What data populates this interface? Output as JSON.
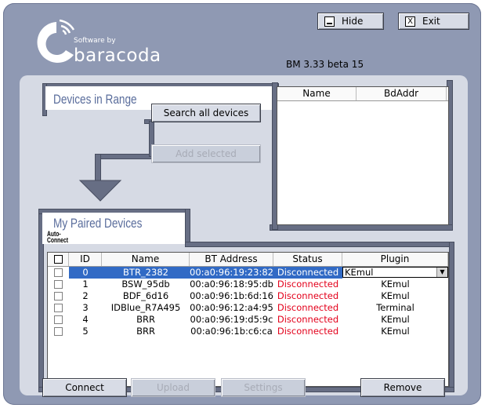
{
  "window": {
    "logo_small": "Software by",
    "logo_big": "baracoda",
    "version": "BM 3.33 beta 15",
    "hide_label": "Hide",
    "exit_label": "Exit",
    "exit_icon": "X"
  },
  "range": {
    "title": "Devices in Range",
    "search_label": "Search all devices",
    "add_label": "Add selected",
    "columns": [
      "Name",
      "BdAddr"
    ]
  },
  "paired": {
    "title": "My Paired Devices",
    "autoconnect_label_1": "Auto-",
    "autoconnect_label_2": "Connect",
    "columns": [
      "ID",
      "Name",
      "BT Address",
      "Status",
      "Plugin"
    ],
    "rows": [
      {
        "id": "0",
        "name": "BTR_2382",
        "address": "00:a0:96:19:23:82",
        "status": "Disconnected",
        "plugin": "KEmul"
      },
      {
        "id": "1",
        "name": "BSW_95db",
        "address": "00:a0:96:18:95:db",
        "status": "Disconnected",
        "plugin": "KEmul"
      },
      {
        "id": "2",
        "name": "BDF_6d16",
        "address": "00:a0:96:1b:6d:16",
        "status": "Disconnected",
        "plugin": "KEmul"
      },
      {
        "id": "3",
        "name": "IDBlue_R7A495",
        "address": "00:a0:96:12:a4:95",
        "status": "Disconnected",
        "plugin": "Terminal"
      },
      {
        "id": "4",
        "name": "BRR",
        "address": "00:a0:96:19:d5:9c",
        "status": "Disconnected",
        "plugin": "KEmul"
      },
      {
        "id": "5",
        "name": "BRR",
        "address": "00:a0:96:1b:c6:ca",
        "status": "Disconnected",
        "plugin": "KEmul"
      }
    ],
    "connect_label": "Connect",
    "upload_label": "Upload",
    "settings_label": "Settings",
    "remove_label": "Remove"
  },
  "colors": {
    "frame": "#8f99b3",
    "panel": "#d6dae4",
    "pipe": "#676e84",
    "title_text": "#5a6d9c",
    "selection": "#316ac5",
    "status_disconnected": "#e3001b"
  }
}
